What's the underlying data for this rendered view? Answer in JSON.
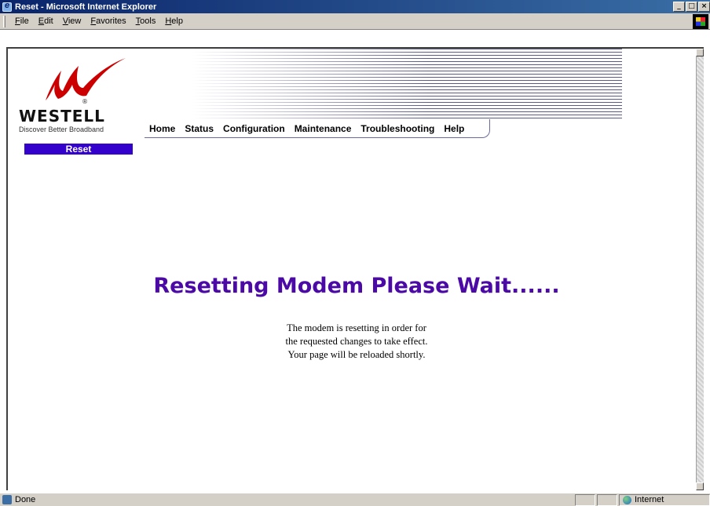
{
  "window": {
    "title": "Reset - Microsoft Internet Explorer",
    "min_glyph": "_",
    "max_glyph": "□",
    "close_glyph": "×"
  },
  "menu": {
    "items": [
      {
        "label": "File"
      },
      {
        "label": "Edit"
      },
      {
        "label": "View"
      },
      {
        "label": "Favorites"
      },
      {
        "label": "Tools"
      },
      {
        "label": "Help"
      }
    ]
  },
  "brand": {
    "name": "WESTELL",
    "tagline": "Discover Better Broadband",
    "registered_mark": "®",
    "logo_color": "#cc0000"
  },
  "nav": {
    "items": [
      {
        "label": "Home"
      },
      {
        "label": "Status"
      },
      {
        "label": "Configuration"
      },
      {
        "label": "Maintenance"
      },
      {
        "label": "Troubleshooting"
      },
      {
        "label": "Help"
      }
    ]
  },
  "section_tab": {
    "label": "Reset",
    "color": "#3300cc"
  },
  "main": {
    "headline": "Resetting Modem Please Wait......",
    "headline_color": "#4b0aa6",
    "message_lines": [
      "The modem is resetting in order for",
      "the requested changes to take effect.",
      "Your page will be reloaded shortly."
    ]
  },
  "status_bar": {
    "text": "Done",
    "zone": "Internet"
  }
}
